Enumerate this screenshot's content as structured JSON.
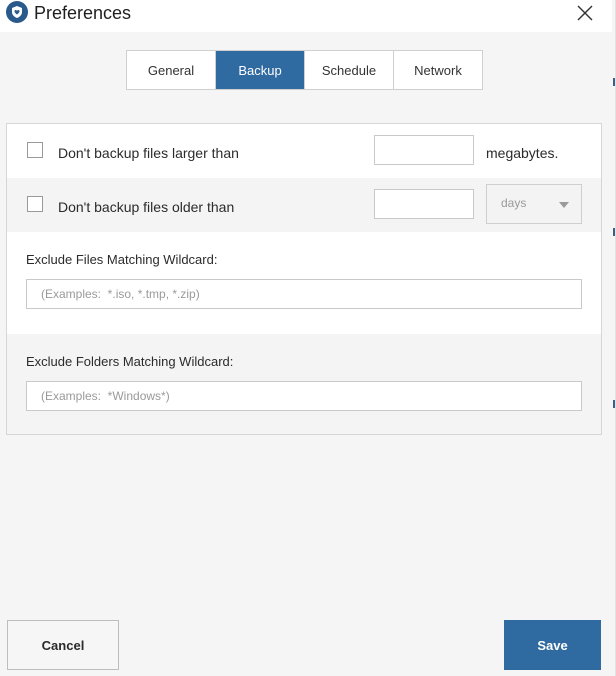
{
  "window": {
    "title": "Preferences"
  },
  "tabs": [
    {
      "label": "General",
      "active": false
    },
    {
      "label": "Backup",
      "active": true
    },
    {
      "label": "Schedule",
      "active": false
    },
    {
      "label": "Network",
      "active": false
    }
  ],
  "backup": {
    "size_limit": {
      "label": "Don't backup files larger than",
      "checked": false,
      "value": "",
      "unit": "megabytes."
    },
    "age_limit": {
      "label": "Don't backup files older than",
      "checked": false,
      "value": "",
      "unit_selected": "days"
    },
    "exclude_files": {
      "label": "Exclude Files Matching Wildcard:",
      "value": "",
      "placeholder": "(Examples:  *.iso, *.tmp, *.zip)"
    },
    "exclude_folders": {
      "label": "Exclude Folders Matching Wildcard:",
      "value": "",
      "placeholder": "(Examples:  *Windows*)"
    }
  },
  "footer": {
    "cancel_label": "Cancel",
    "save_label": "Save"
  },
  "colors": {
    "accent": "#2f6aa0",
    "app_icon": "#2a5a8c"
  },
  "icons": {
    "app": "shield-heart-icon",
    "close": "close-icon",
    "dropdown": "caret-down-icon"
  }
}
